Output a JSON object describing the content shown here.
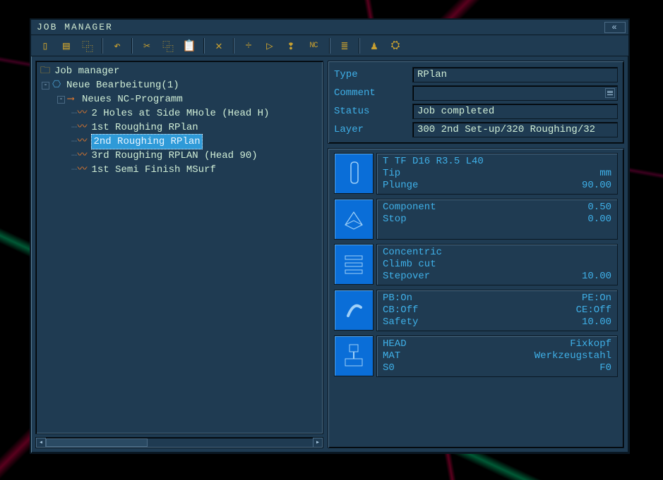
{
  "window": {
    "title": "JOB MANAGER"
  },
  "toolbar_icons": [
    {
      "name": "new-icon",
      "glyph": "▯"
    },
    {
      "name": "save-icon",
      "glyph": "▤"
    },
    {
      "name": "copy-icon",
      "glyph": "⿻"
    },
    {
      "name": "sep"
    },
    {
      "name": "undo-icon",
      "glyph": "↶"
    },
    {
      "name": "sep"
    },
    {
      "name": "cut-icon",
      "glyph": "✂"
    },
    {
      "name": "copy2-icon",
      "glyph": "⿻"
    },
    {
      "name": "paste-icon",
      "glyph": "📋"
    },
    {
      "name": "sep"
    },
    {
      "name": "delete-icon",
      "glyph": "✕"
    },
    {
      "name": "sep"
    },
    {
      "name": "divide-icon",
      "glyph": "÷"
    },
    {
      "name": "play-icon",
      "glyph": "▷"
    },
    {
      "name": "info-icon",
      "glyph": "❢"
    },
    {
      "name": "nc-icon",
      "glyph": "NC"
    },
    {
      "name": "sep"
    },
    {
      "name": "list-icon",
      "glyph": "≣"
    },
    {
      "name": "sep"
    },
    {
      "name": "robot-icon",
      "glyph": "♟"
    },
    {
      "name": "gear-icon",
      "glyph": "⛭"
    }
  ],
  "tree": {
    "root": "Job manager",
    "l1": "Neue Bearbeitung(1)",
    "l2": "Neues NC-Programm",
    "ops": [
      {
        "label": "2 Holes at Side MHole (Head H)",
        "selected": false
      },
      {
        "label": "1st Roughing RPlan",
        "selected": false
      },
      {
        "label": "2nd Roughing RPlan",
        "selected": true
      },
      {
        "label": "3rd Roughing RPLAN (Head 90)",
        "selected": false
      },
      {
        "label": "1st Semi Finish MSurf",
        "selected": false
      }
    ]
  },
  "props": {
    "type_label": "Type",
    "type_value": "RPlan",
    "comment_label": "Comment",
    "comment_value": "",
    "status_label": "Status",
    "status_value": "Job completed",
    "layer_label": "Layer",
    "layer_value": "300 2nd Set-up/320 Roughing/32"
  },
  "cards": [
    {
      "icon": "tool-icon",
      "lines": [
        {
          "l": "T TF D16 R3.5 L40",
          "r": ""
        },
        {
          "l": "Tip",
          "r": "mm"
        },
        {
          "l": "Plunge",
          "r": "90.00"
        }
      ]
    },
    {
      "icon": "plane-icon",
      "lines": [
        {
          "l": "Component",
          "r": "0.50"
        },
        {
          "l": "Stop",
          "r": "0.00"
        }
      ]
    },
    {
      "icon": "strategy-icon",
      "lines": [
        {
          "l": "Concentric",
          "r": ""
        },
        {
          "l": "Climb cut",
          "r": ""
        },
        {
          "l": "Stepover",
          "r": "10.00"
        }
      ]
    },
    {
      "icon": "link-icon",
      "lines": [
        {
          "l": "PB:On",
          "r": "PE:On"
        },
        {
          "l": "CB:Off",
          "r": "CE:Off"
        },
        {
          "l": "Safety",
          "r": "10.00"
        }
      ]
    },
    {
      "icon": "machine-icon",
      "lines": [
        {
          "l": "HEAD",
          "r": "Fixkopf"
        },
        {
          "l": "MAT",
          "r": "Werkzeugstahl"
        },
        {
          "l": "S0",
          "r": "F0"
        }
      ]
    }
  ]
}
